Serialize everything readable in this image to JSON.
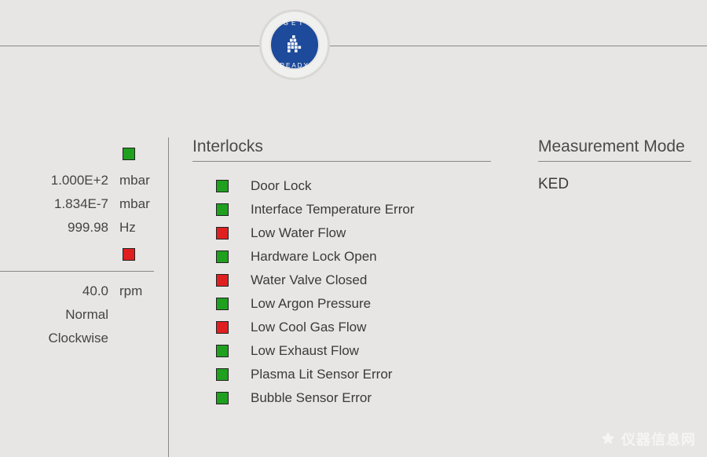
{
  "badge": {
    "top": "GET",
    "bottom": "READY"
  },
  "colors": {
    "ok": "#1fa01f",
    "fault": "#e02020"
  },
  "leftPanel": {
    "topIndicator": "ok",
    "readings": [
      {
        "value": "1.000E+2",
        "unit": "mbar"
      },
      {
        "value": "1.834E-7",
        "unit": "mbar"
      },
      {
        "value": "999.98",
        "unit": "Hz"
      }
    ],
    "secondIndicator": "fault",
    "pump": {
      "value": "40.0",
      "unit": "rpm"
    },
    "status1": "Normal",
    "status2": "Clockwise"
  },
  "interlocks": {
    "title": "Interlocks",
    "items": [
      {
        "state": "ok",
        "label": "Door Lock"
      },
      {
        "state": "ok",
        "label": "Interface Temperature Error"
      },
      {
        "state": "fault",
        "label": "Low Water Flow"
      },
      {
        "state": "ok",
        "label": "Hardware Lock Open"
      },
      {
        "state": "fault",
        "label": "Water Valve Closed"
      },
      {
        "state": "ok",
        "label": "Low Argon Pressure"
      },
      {
        "state": "fault",
        "label": "Low Cool Gas Flow"
      },
      {
        "state": "ok",
        "label": "Low Exhaust Flow"
      },
      {
        "state": "ok",
        "label": "Plasma Lit Sensor Error"
      },
      {
        "state": "ok",
        "label": "Bubble Sensor Error"
      }
    ]
  },
  "measurementMode": {
    "title": "Measurement Mode",
    "value": "KED"
  },
  "watermark": "仪器信息网"
}
